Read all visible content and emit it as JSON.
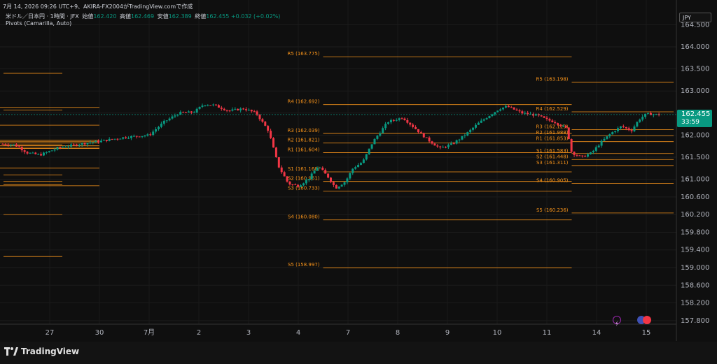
{
  "header": {
    "caption": "7月 14, 2026 09:26 UTC+9、AKIRA-FX2004がTradingView.comで作成"
  },
  "symbol": {
    "name": "米ドル／日本円 · 1時間 · JFX",
    "open_label": "始値",
    "open": "162.420",
    "high_label": "高値",
    "high": "162.469",
    "low_label": "安値",
    "low": "162.389",
    "close_label": "終値",
    "close": "162.455",
    "change": "+0.032 (+0.02%)"
  },
  "indicator": {
    "label": "Pivots (Camarilla, Auto)"
  },
  "currency": "JPY",
  "last_price": {
    "price": "162.455",
    "countdown": "33:59"
  },
  "footer": {
    "brand": "TradingView"
  },
  "colors": {
    "bull": "#089981",
    "bear": "#f23645",
    "pivot": "#f7931a",
    "background": "#0f0f0f"
  },
  "chart_data": {
    "type": "candlestick",
    "y_axis": {
      "ticks": [
        "164.500",
        "164.000",
        "163.500",
        "163.000",
        "162.500",
        "162.000",
        "161.500",
        "161.000",
        "160.600",
        "160.200",
        "159.800",
        "159.400",
        "159.000",
        "158.600",
        "158.200",
        "157.800"
      ],
      "range": [
        157.75,
        164.6
      ]
    },
    "x_axis": {
      "ticks": [
        {
          "label": "27",
          "day": 0
        },
        {
          "label": "30",
          "day": 1
        },
        {
          "label": "7月",
          "day": 2
        },
        {
          "label": "2",
          "day": 3
        },
        {
          "label": "3",
          "day": 4
        },
        {
          "label": "4",
          "day": 5
        },
        {
          "label": "7",
          "day": 6
        },
        {
          "label": "8",
          "day": 7
        },
        {
          "label": "9",
          "day": 8
        },
        {
          "label": "10",
          "day": 9
        },
        {
          "label": "11",
          "day": 10
        },
        {
          "label": "14",
          "day": 11
        },
        {
          "label": "15",
          "day": 12
        }
      ]
    },
    "price_path": [
      [
        -1.0,
        161.8
      ],
      [
        -0.7,
        161.78
      ],
      [
        -0.45,
        161.6
      ],
      [
        -0.2,
        161.55
      ],
      [
        0.2,
        161.72
      ],
      [
        0.6,
        161.8
      ],
      [
        1.0,
        161.86
      ],
      [
        1.5,
        161.95
      ],
      [
        2.0,
        162.0
      ],
      [
        2.3,
        162.3
      ],
      [
        2.6,
        162.5
      ],
      [
        2.9,
        162.52
      ],
      [
        3.1,
        162.7
      ],
      [
        3.3,
        162.68
      ],
      [
        3.6,
        162.55
      ],
      [
        3.9,
        162.6
      ],
      [
        4.15,
        162.5
      ],
      [
        4.4,
        162.1
      ],
      [
        4.6,
        161.3
      ],
      [
        4.8,
        160.9
      ],
      [
        5.0,
        160.85
      ],
      [
        5.2,
        161.0
      ],
      [
        5.4,
        161.3
      ],
      [
        5.6,
        161.05
      ],
      [
        5.75,
        160.8
      ],
      [
        5.95,
        160.95
      ],
      [
        6.1,
        161.25
      ],
      [
        6.3,
        161.4
      ],
      [
        6.5,
        161.85
      ],
      [
        6.8,
        162.3
      ],
      [
        7.1,
        162.4
      ],
      [
        7.4,
        162.1
      ],
      [
        7.6,
        161.9
      ],
      [
        7.85,
        161.7
      ],
      [
        8.1,
        161.8
      ],
      [
        8.35,
        162.0
      ],
      [
        8.6,
        162.25
      ],
      [
        8.85,
        162.45
      ],
      [
        9.05,
        162.6
      ],
      [
        9.2,
        162.65
      ],
      [
        9.5,
        162.5
      ],
      [
        9.8,
        162.45
      ],
      [
        10.0,
        162.35
      ],
      [
        10.15,
        162.3
      ],
      [
        10.4,
        162.15
      ],
      [
        10.5,
        161.6
      ],
      [
        10.7,
        161.5
      ],
      [
        10.9,
        161.6
      ],
      [
        11.1,
        161.85
      ],
      [
        11.3,
        162.05
      ],
      [
        11.5,
        162.2
      ],
      [
        11.7,
        162.1
      ],
      [
        11.85,
        162.35
      ],
      [
        12.0,
        162.48
      ],
      [
        12.3,
        162.46
      ]
    ],
    "pivots": [
      {
        "period": [
          -1.0,
          1.0
        ],
        "labels_shown": true,
        "levels": [
          {
            "name": "R5",
            "value": 162.627
          },
          {
            "name": "R4",
            "value": 162.226
          },
          {
            "name": "R3",
            "value": 161.883
          },
          {
            "name": "R2",
            "value": 161.852
          },
          {
            "name": "R1",
            "value": 161.821
          },
          {
            "name": "S1",
            "value": 161.759
          },
          {
            "name": "S2",
            "value": 161.728
          },
          {
            "name": "S3",
            "value": 161.697
          },
          {
            "name": "S4",
            "value": 161.254
          },
          {
            "name": "S5",
            "value": 160.853
          }
        ]
      },
      {
        "period": [
          5.5,
          10.5
        ],
        "labels_shown": true,
        "levels": [
          {
            "name": "R5",
            "value": 163.775
          },
          {
            "name": "R4",
            "value": 162.692
          },
          {
            "name": "R3",
            "value": 162.039
          },
          {
            "name": "R2",
            "value": 161.821
          },
          {
            "name": "R1",
            "value": 161.604
          },
          {
            "name": "S1",
            "value": 161.168
          },
          {
            "name": "S2",
            "value": 160.951
          },
          {
            "name": "S3",
            "value": 160.733
          },
          {
            "name": "S4",
            "value": 160.08
          },
          {
            "name": "S5",
            "value": 158.997
          }
        ]
      },
      {
        "period": [
          10.5,
          12.55
        ],
        "labels_shown": true,
        "levels": [
          {
            "name": "R5",
            "value": 163.198
          },
          {
            "name": "R4",
            "value": 162.529
          },
          {
            "name": "R3",
            "value": 162.123
          },
          {
            "name": "R2",
            "value": 161.988
          },
          {
            "name": "R1",
            "value": 161.853
          },
          {
            "name": "S1",
            "value": 161.583
          },
          {
            "name": "S2",
            "value": 161.448
          },
          {
            "name": "S3",
            "value": 161.311
          },
          {
            "name": "S4",
            "value": 160.905
          },
          {
            "name": "S5",
            "value": 160.236
          }
        ]
      }
    ],
    "extra_left_levels": [
      163.4,
      162.57,
      161.78,
      161.1,
      160.95,
      160.88,
      160.2,
      159.25
    ]
  }
}
